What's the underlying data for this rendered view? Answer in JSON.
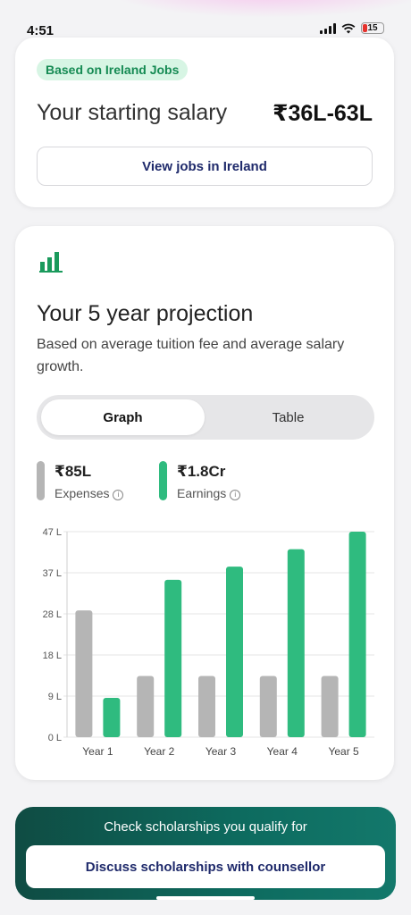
{
  "status_bar": {
    "time": "4:51",
    "battery": "15"
  },
  "salary_card": {
    "badge": "Based on Ireland Jobs",
    "label": "Your starting salary",
    "value": "₹36L-63L",
    "button": "View jobs in Ireland"
  },
  "projection": {
    "title": "Your 5 year projection",
    "subtitle": "Based on average tuition fee and average salary growth.",
    "tabs": [
      {
        "label": "Graph",
        "active": true
      },
      {
        "label": "Table",
        "active": false
      }
    ],
    "legend": [
      {
        "value": "₹85L",
        "label": "Expenses",
        "color": "#b5b5b5"
      },
      {
        "value": "₹1.8Cr",
        "label": "Earnings",
        "color": "#2fbb7f"
      }
    ]
  },
  "chart_data": {
    "type": "bar",
    "categories": [
      "Year 1",
      "Year 2",
      "Year 3",
      "Year 4",
      "Year 5"
    ],
    "series": [
      {
        "name": "Expenses",
        "color": "#b5b5b5",
        "values": [
          29,
          14,
          14,
          14,
          14
        ]
      },
      {
        "name": "Earnings",
        "color": "#2fbb7f",
        "values": [
          9,
          36,
          39,
          43,
          47
        ]
      }
    ],
    "yticks": [
      "0 L",
      "9 L",
      "18 L",
      "28 L",
      "37 L",
      "47 L"
    ],
    "ylim": [
      0,
      47
    ],
    "grid": true
  },
  "scholarship": {
    "text": "Check scholarships you qualify for",
    "button": "Discuss scholarships with counsellor"
  }
}
